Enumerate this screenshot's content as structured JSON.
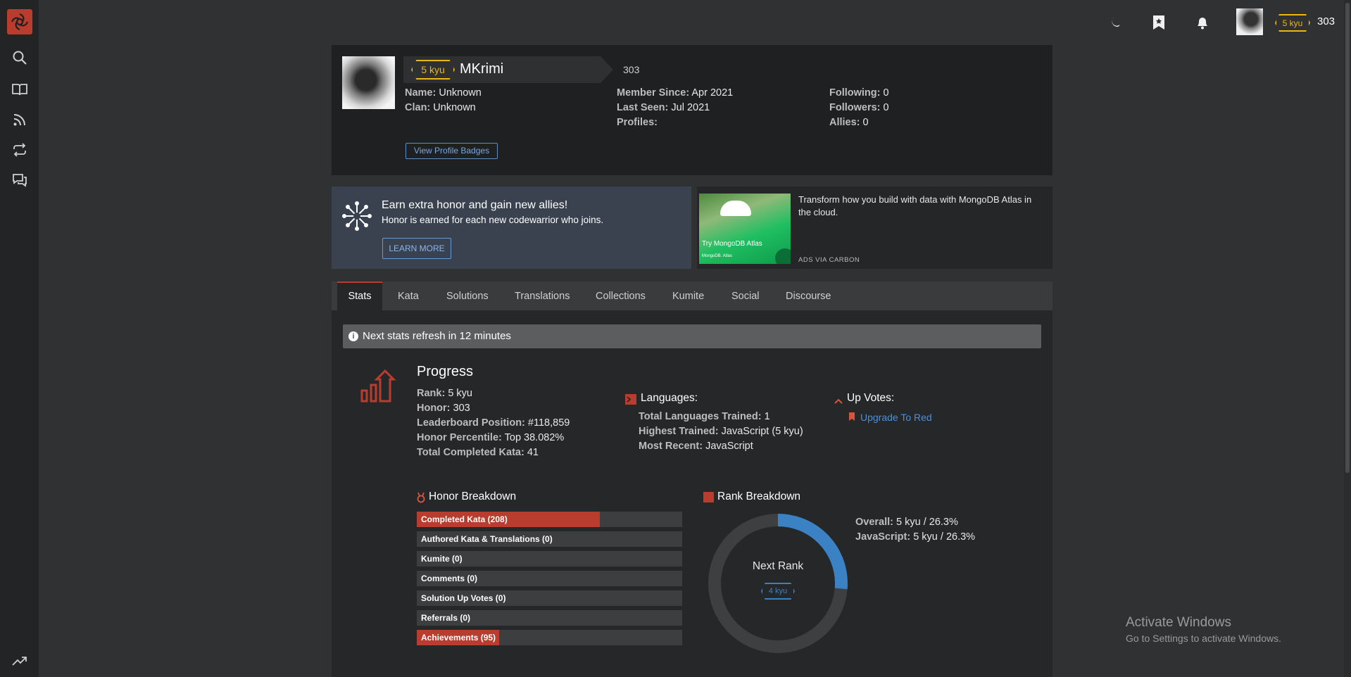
{
  "colors": {
    "accent": "#b93d2e",
    "rank_yellow": "#ecb613",
    "link_blue": "#3b82c4",
    "sidebar_bg": "#232426",
    "panel_bg": "#1f2022"
  },
  "sidebar": {
    "icons": [
      "logo-icon",
      "search-icon",
      "book-icon",
      "rss-icon",
      "repeat-icon",
      "chat-icon",
      "trending-icon"
    ]
  },
  "topbar": {
    "rank": "5 kyu",
    "honor": "303",
    "icons": [
      "moon-icon",
      "bookmark-icon",
      "bell-icon",
      "avatar"
    ]
  },
  "profile": {
    "rank": "5 kyu",
    "username": "MKrimi",
    "honor": "303",
    "name_label": "Name:",
    "name": "Unknown",
    "clan_label": "Clan:",
    "clan": "Unknown",
    "member_since_label": "Member Since:",
    "member_since": "Apr 2021",
    "last_seen_label": "Last Seen:",
    "last_seen": "Jul 2021",
    "profiles_label": "Profiles:",
    "following_label": "Following:",
    "following": "0",
    "followers_label": "Followers:",
    "followers": "0",
    "allies_label": "Allies:",
    "allies": "0",
    "badges_button": "View Profile Badges"
  },
  "promo": {
    "title": "Earn extra honor and gain new allies!",
    "subtitle": "Honor is earned for each new codewarrior who joins.",
    "button": "LEARN MORE"
  },
  "ad": {
    "image_caption": "Try MongoDB Atlas",
    "image_brand": "MongoDB. Atlas",
    "text": "Transform how you build with data with MongoDB Atlas in the cloud.",
    "footer": "ADS VIA CARBON"
  },
  "tabs": [
    {
      "label": "Stats"
    },
    {
      "label": "Kata"
    },
    {
      "label": "Solutions"
    },
    {
      "label": "Translations"
    },
    {
      "label": "Collections"
    },
    {
      "label": "Kumite"
    },
    {
      "label": "Social"
    },
    {
      "label": "Discourse"
    }
  ],
  "notice": "Next stats refresh in 12 minutes",
  "progress": {
    "title": "Progress",
    "rank_label": "Rank:",
    "rank": "5 kyu",
    "honor_label": "Honor:",
    "honor": "303",
    "leaderboard_label": "Leaderboard Position:",
    "leaderboard": "#118,859",
    "percentile_label": "Honor Percentile:",
    "percentile": "Top 38.082%",
    "completed_label": "Total Completed Kata:",
    "completed": "41"
  },
  "languages": {
    "title": "Languages:",
    "trained_label": "Total Languages Trained:",
    "trained": "1",
    "highest_label": "Highest Trained:",
    "highest": "JavaScript (5 kyu)",
    "recent_label": "Most Recent:",
    "recent": "JavaScript"
  },
  "upvotes": {
    "title": "Up Votes:",
    "link": "Upgrade To Red"
  },
  "honor_breakdown": {
    "title": "Honor Breakdown",
    "rows": [
      {
        "label": "Completed Kata (208)",
        "fraction": 0.69
      },
      {
        "label": "Authored Kata & Translations (0)",
        "fraction": 0
      },
      {
        "label": "Kumite (0)",
        "fraction": 0
      },
      {
        "label": "Comments (0)",
        "fraction": 0
      },
      {
        "label": "Solution Up Votes (0)",
        "fraction": 0
      },
      {
        "label": "Referrals (0)",
        "fraction": 0
      },
      {
        "label": "Achievements (95)",
        "fraction": 0.31
      }
    ]
  },
  "rank_breakdown": {
    "title": "Rank Breakdown",
    "center_label": "Next Rank",
    "next_rank": "4 kyu",
    "progress_fraction": 0.263,
    "overall_label": "Overall:",
    "overall": "5 kyu / 26.3%",
    "js_label": "JavaScript:",
    "js": "5 kyu / 26.3%"
  },
  "windows": {
    "title": "Activate Windows",
    "subtitle": "Go to Settings to activate Windows."
  }
}
